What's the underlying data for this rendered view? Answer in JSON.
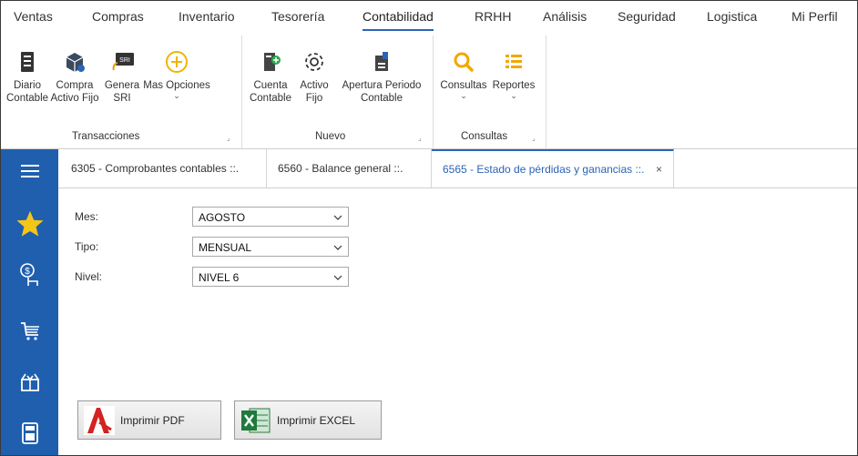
{
  "menu": [
    "Ventas",
    "Compras",
    "Inventario",
    "Tesorería",
    "Contabilidad",
    "RRHH",
    "Análisis",
    "Seguridad",
    "Logistica",
    "Mi Perfil"
  ],
  "active_menu": "Contabilidad",
  "ribbon": {
    "transacciones": {
      "label": "Transacciones",
      "buttons": [
        {
          "label": "Diario\nContable",
          "icon": "ledger-icon"
        },
        {
          "label": "Compra\nActivo Fijo",
          "icon": "asset-box-icon"
        },
        {
          "label": "Genera\nSRI",
          "icon": "sri-icon",
          "caret": "⌄"
        },
        {
          "label": "Mas Opciones",
          "icon": "plus-circle-icon",
          "caret": "⌄"
        }
      ]
    },
    "nuevo": {
      "label": "Nuevo",
      "buttons": [
        {
          "label": "Cuenta\nContable",
          "icon": "account-doc-icon"
        },
        {
          "label": "Activo\nFijo",
          "icon": "gear-icon"
        },
        {
          "label": "Apertura Periodo\nContable",
          "icon": "period-doc-icon"
        }
      ]
    },
    "consultas": {
      "label": "Consultas",
      "buttons": [
        {
          "label": "Consultas",
          "icon": "search-icon",
          "caret": "⌄"
        },
        {
          "label": "Reportes",
          "icon": "list-icon",
          "caret": "⌄"
        }
      ]
    }
  },
  "sidenav": [
    "hamburger-icon",
    "star-icon",
    "money-hand-icon",
    "cart-icon",
    "gift-icon",
    "calculator-icon"
  ],
  "tabs": [
    {
      "label": "6305 - Comprobantes contables ::."
    },
    {
      "label": "6560 - Balance general ::."
    },
    {
      "label": "6565 - Estado de pérdidas y ganancias ::.",
      "close": "×"
    }
  ],
  "form": {
    "mes": {
      "label": "Mes:",
      "value": "AGOSTO"
    },
    "tipo": {
      "label": "Tipo:",
      "value": "MENSUAL"
    },
    "nivel": {
      "label": "Nivel:",
      "value": "NIVEL 6"
    }
  },
  "buttons": {
    "pdf": "Imprimir PDF",
    "excel": "Imprimir EXCEL"
  },
  "colors": {
    "accent": "#2b63b5",
    "nav": "#1f5fae",
    "star": "#f5c518",
    "search": "#f0a800"
  }
}
